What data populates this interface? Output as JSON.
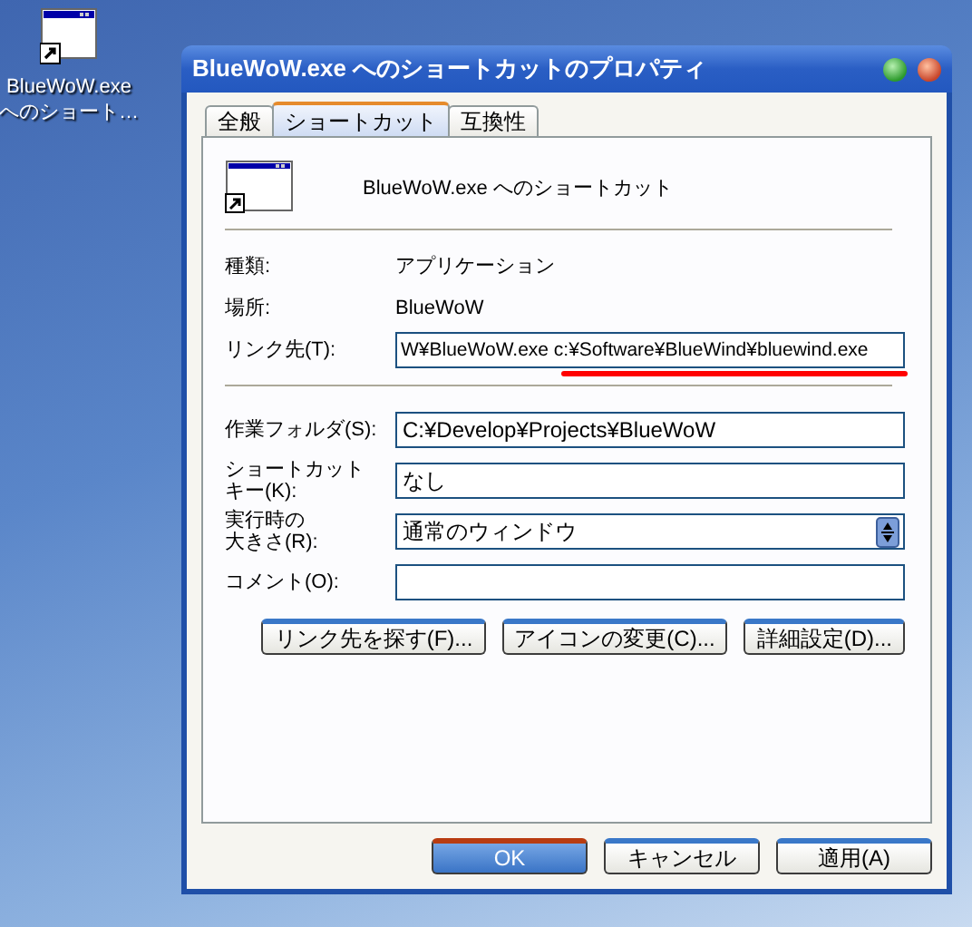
{
  "desktop_icon": {
    "label_lines": [
      "BlueWoW.exe",
      "へのショート…"
    ]
  },
  "window": {
    "title": "BlueWoW.exe へのショートカットのプロパティ"
  },
  "tabs": [
    {
      "label": "全般",
      "selected": false
    },
    {
      "label": "ショートカット",
      "selected": true
    },
    {
      "label": "互換性",
      "selected": false
    }
  ],
  "shortcut_name": "BlueWoW.exe へのショートカット",
  "info_rows": [
    {
      "label": "種類:",
      "value": "アプリケーション"
    },
    {
      "label": "場所:",
      "value": "BlueWoW"
    }
  ],
  "target": {
    "label": "リンク先(T):",
    "value": "W¥BlueWoW.exe c:¥Software¥BlueWind¥bluewind.exe"
  },
  "fields": [
    {
      "kind": "text",
      "label_lines": [
        "作業フォルダ(S):"
      ],
      "value": "C:¥Develop¥Projects¥BlueWoW"
    },
    {
      "kind": "text",
      "label_lines": [
        "ショートカット",
        "キー(K):"
      ],
      "value": "なし"
    },
    {
      "kind": "select",
      "label_lines": [
        "実行時の",
        "大きさ(R):"
      ],
      "value": "通常のウィンドウ"
    },
    {
      "kind": "text",
      "label_lines": [
        "コメント(O):"
      ]
    }
  ],
  "action_buttons": [
    "リンク先を探す(F)...",
    "アイコンの変更(C)...",
    "詳細設定(D)..."
  ],
  "dialog_buttons": [
    {
      "label": "OK",
      "default": true
    },
    {
      "label": "キャンセル",
      "default": false
    },
    {
      "label": "適用(A)",
      "default": false
    }
  ]
}
